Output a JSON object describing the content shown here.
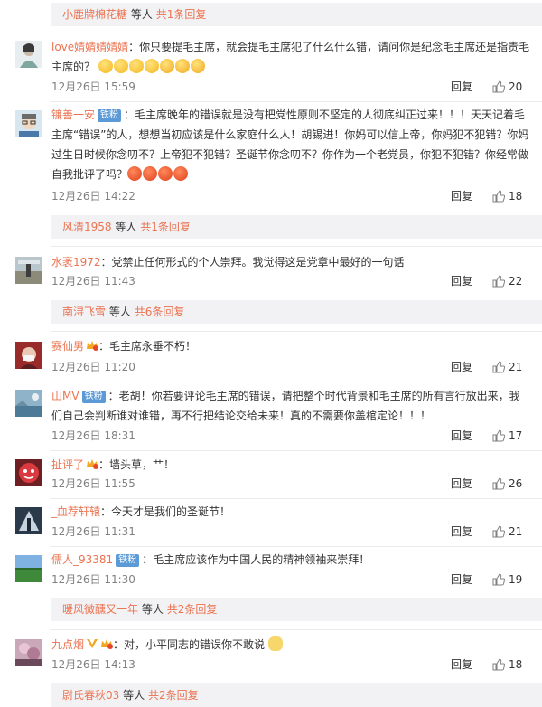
{
  "labels": {
    "reply": "回复",
    "etc_people": "等人",
    "total_prefix": "共",
    "replies_suffix": "条回复"
  },
  "reply_summaries": [
    {
      "user": "小鹿牌棉花糖",
      "count_text": "共1条回复"
    },
    {
      "user": "风清1958",
      "count_text": "共1条回复"
    },
    {
      "user": "南浔飞雪",
      "count_text": "共6条回复"
    },
    {
      "user": "暖风微醺又一年",
      "count_text": "共2条回复"
    },
    {
      "user": "尉氏春秋03",
      "count_text": "共2条回复"
    }
  ],
  "comments": [
    {
      "user": "love婧婧婧婧婧",
      "badge": "",
      "text": "：你只要提毛主席，就会提毛主席犯了什么什么错，请问你是纪念毛主席还是指责毛主席的？",
      "time": "12月26日 15:59",
      "likes": "20"
    },
    {
      "user": "镰善一安",
      "badge": "铁粉",
      "text": "：毛主席晚年的错误就是没有把党性原则不坚定的人彻底纠正过来！！！天天记着毛主席“错误”的人，想想当初应该是什么家庭什么人！胡锡进！你妈可以信上帝，你妈犯不犯错？你妈过生日时候你念叨不？上帝犯不犯错？圣诞节你念叨不？你作为一个老党员，你犯不犯错？你经常做自我批评了吗？",
      "time": "12月26日 14:22",
      "likes": "18"
    },
    {
      "user": "水袤1972",
      "badge": "",
      "text": "：党禁止任何形式的个人崇拜。我觉得这是党章中最好的一句话",
      "time": "12月26日 11:43",
      "likes": "22"
    },
    {
      "user": "赛仙男",
      "badge": "",
      "text": "：毛主席永垂不朽！",
      "time": "12月26日 11:20",
      "likes": "21"
    },
    {
      "user": "山MV",
      "badge": "铁粉",
      "text": "：老胡！你若要评论毛主席的错误，请把整个时代背景和毛主席的所有言行放出来，我们自己会判断谁对谁错，再不行把结论交给未来！真的不需要你盖棺定论！！！",
      "time": "12月26日 18:31",
      "likes": "17"
    },
    {
      "user": "扯评了",
      "badge": "",
      "text": "：墙头草，艹！",
      "time": "12月26日 11:55",
      "likes": "26"
    },
    {
      "user": "_血荐轩辕",
      "badge": "",
      "text": "：今天才是我们的圣诞节！",
      "time": "12月26日 11:31",
      "likes": "21"
    },
    {
      "user": "儒人_93381",
      "badge": "铁粉",
      "text": "：毛主席应该作为中国人民的精神领袖来崇拜！",
      "time": "12月26日 11:30",
      "likes": "19"
    },
    {
      "user": "九点烟",
      "badge": "",
      "text": "：对，小平同志的错误你不敢说",
      "time": "12月26日 14:13",
      "likes": "18"
    }
  ]
}
